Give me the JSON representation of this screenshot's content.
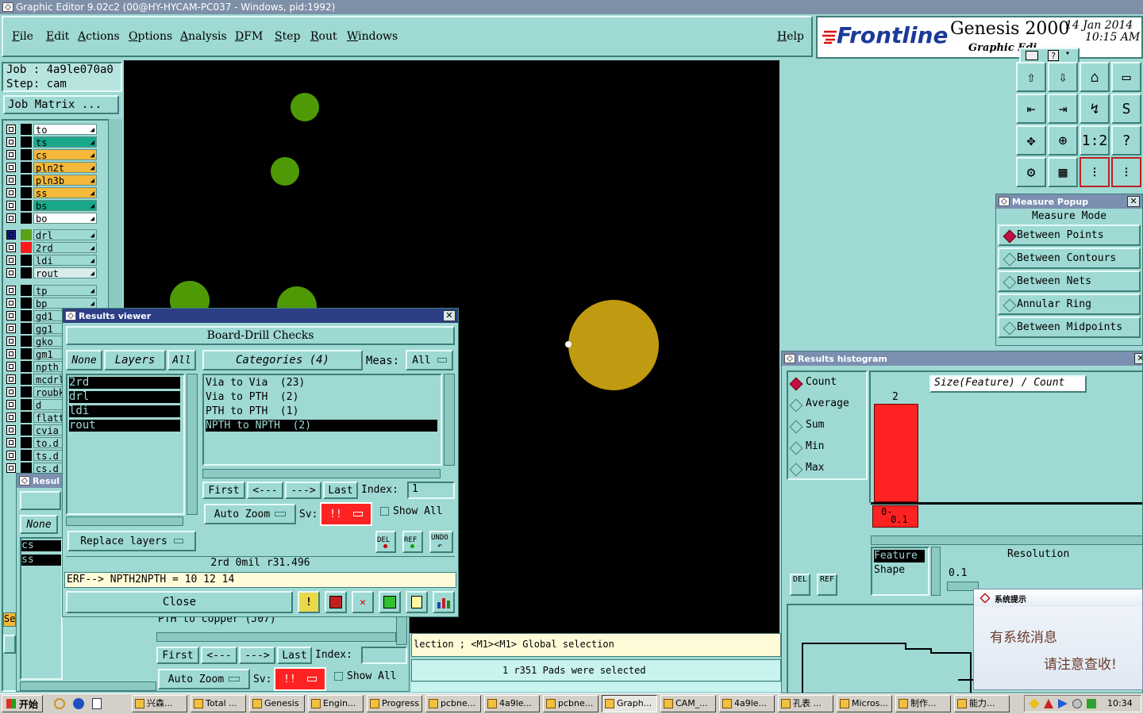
{
  "window_title": "Graphic Editor 9.02c2 (00@HY-HYCAM-PC037 - Windows, pid:1992)",
  "menu": {
    "items": [
      "File",
      "Edit",
      "Actions",
      "Options",
      "Analysis",
      "DFM",
      "Step",
      "Rout",
      "Windows"
    ],
    "help": "Help"
  },
  "brand": {
    "logo": "Frontline",
    "product": "Genesis 2000",
    "subtitle": "Graphic Edi",
    "date": "14 Jan 2014",
    "time": "10:15 AM"
  },
  "job": {
    "job_label": "Job : 4a9le070a0",
    "step_label": "Step: cam",
    "matrix_button": "Job Matrix ..."
  },
  "layers_group1": [
    {
      "name": "to",
      "color": "#ffffff"
    },
    {
      "name": "ts",
      "color": "#1aa88a"
    },
    {
      "name": "cs",
      "color": "#f5b83a"
    },
    {
      "name": "pln2t",
      "color": "#f5b83a"
    },
    {
      "name": "pln3b",
      "color": "#f5b83a"
    },
    {
      "name": "ss",
      "color": "#f5b83a"
    },
    {
      "name": "bs",
      "color": "#1aa88a"
    },
    {
      "name": "bo",
      "color": "#ffffff"
    }
  ],
  "layers_group2": [
    {
      "name": "drl",
      "color": "#9fd9d3",
      "swatch": "#5aa01a",
      "sel": "#1a1a8a"
    },
    {
      "name": "2rd",
      "color": "#9fd9d3",
      "swatch": "#ff1a1a"
    },
    {
      "name": "ldi",
      "color": "#9fd9d3"
    },
    {
      "name": "rout",
      "color": "#d8ecea"
    }
  ],
  "layers_group3": [
    "tp",
    "bp",
    "gd1",
    "gg1",
    "gko",
    "gm1",
    "npth",
    "mcdrl",
    "roubk",
    "d",
    "flatt",
    "cvia",
    "to.d",
    "ts.d",
    "cs.d"
  ],
  "colors": {
    "panel": "#9fd9d3",
    "canvas": "#000000",
    "drill_pad": "#4e9a06",
    "selected_pad": "#c09a10",
    "histogram_bar": "#ff2222",
    "sv_button": "#ff2222"
  },
  "toolbar_icons": [
    "export-icon",
    "import-icon",
    "home-icon",
    "window-icon",
    "pan-left-icon",
    "pan-right-icon",
    "zoom-fit-icon",
    "snap-icon",
    "fit-screen-icon",
    "zoom-center-icon",
    "ratio-icon",
    "help-icon",
    "settings-icon",
    "grid-icon",
    "drill-check-icon",
    "drill-check-alt-icon"
  ],
  "measure_popup": {
    "title": "Measure Popup",
    "header": "Measure Mode",
    "options": [
      "Between Points",
      "Between Contours",
      "Between Nets",
      "Annular Ring",
      "Between Midpoints"
    ],
    "selected": 0
  },
  "results_histogram": {
    "title": "Results histogram",
    "modes": [
      "Count",
      "Average",
      "Sum",
      "Min",
      "Max"
    ],
    "selected": 0,
    "chart_title": "Size(Feature) / Count",
    "bar_value": "2",
    "bar_label_1": "0-",
    "bar_label_2": "0.1",
    "feature_label": "Feature",
    "shape_label": "Shape",
    "resolution_label": "Resolution",
    "resolution_value": "0.1",
    "del": "DEL",
    "ref": "REF"
  },
  "results_viewer": {
    "title": "Results viewer",
    "header": "Board-Drill Checks",
    "none": "None",
    "layers": "Layers",
    "all": "All",
    "categories": "Categories (4)",
    "meas_label": "Meas:",
    "meas_value": "All",
    "layer_list": [
      "2rd",
      "drl",
      "ldi",
      "rout"
    ],
    "category_list": [
      "Via to Via  (23)",
      "Via to PTH  (2)",
      "PTH to PTH  (1)",
      "NPTH to NPTH  (2)"
    ],
    "selected_category": 3,
    "first": "First",
    "prev": "<---",
    "next": "--->",
    "last": "Last",
    "index_label": "Index:",
    "index_value": "1",
    "auto_zoom": "Auto Zoom",
    "sv_label": "Sv:",
    "sv_value": "!!",
    "show_all": "Show All",
    "replace_layers": "Replace layers",
    "del": "DEL",
    "ref": "REF",
    "undo": "UNDO",
    "status": "2rd  0mil  r31.496",
    "erf": "ERF--> NPTH2NPTH = 10 12 14",
    "close": "Close"
  },
  "back_results": {
    "title": "Resul",
    "none": "None",
    "list": [
      "cs",
      "ss"
    ],
    "se": "Se",
    "partial_category": "PTH to copper (J07)",
    "first": "First",
    "prev": "<---",
    "next": "--->",
    "last": "Last",
    "index_label": "Index:",
    "auto_zoom": "Auto Zoom",
    "sv_label": "Sv:",
    "sv_value": "!!",
    "show_all": "Show All"
  },
  "status_bar": {
    "hint": "lection ; <M1><M1> Global selection",
    "message": "1 r351 Pads were selected"
  },
  "popup_notice": {
    "title": "系统提示",
    "line1": "有系统消息",
    "line2": "请注意查收!"
  },
  "taskbar": {
    "start": "开始",
    "clock": "10:34",
    "tasks": [
      "兴森...",
      "Total ...",
      "Genesis",
      "Engin...",
      "Progress",
      "pcbne...",
      "4a9le...",
      "pcbne...",
      "Graph...",
      "CAM_...",
      "4a9le...",
      "孔表 ...",
      "Micros...",
      "制作...",
      "能力..."
    ],
    "active": 8
  }
}
